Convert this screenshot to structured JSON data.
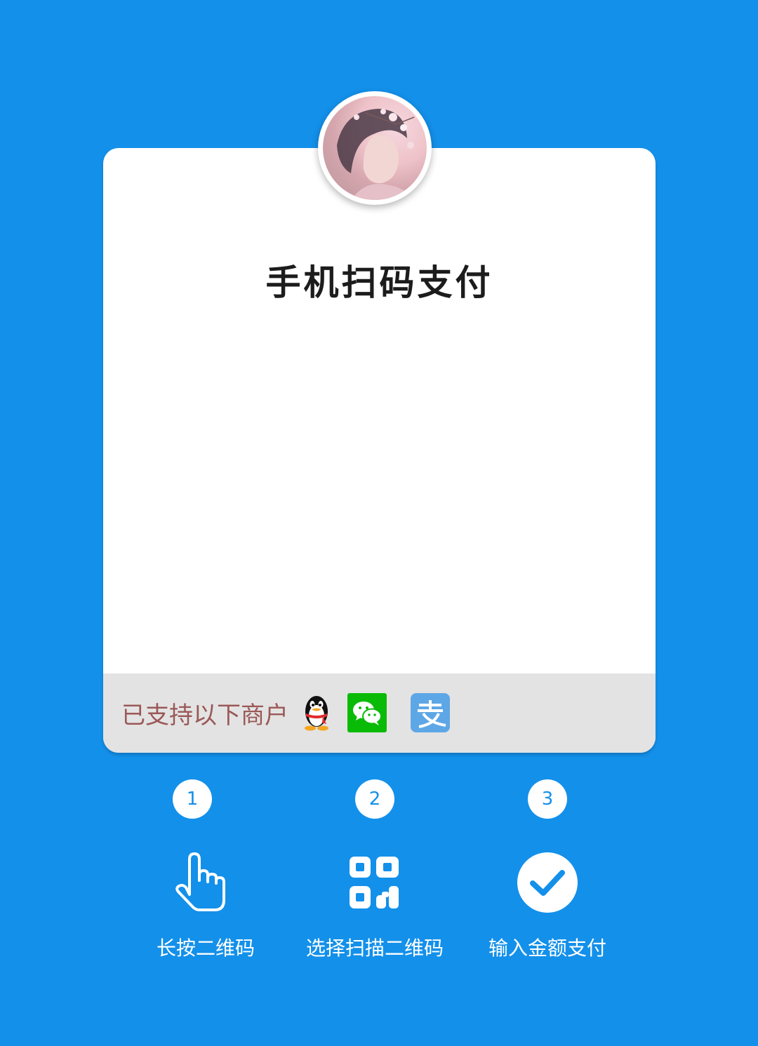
{
  "colors": {
    "background": "#1390ea",
    "card": "#ffffff",
    "footer_bar": "#e3e3e3",
    "footer_text": "#9b5858",
    "wechat_green": "#09bb07",
    "alipay_blue": "#5ea7e6"
  },
  "avatar": {
    "icon": "user-avatar"
  },
  "card": {
    "title": "手机扫码支付"
  },
  "merchants": {
    "label": "已支持以下商户",
    "icons": [
      "qq-penguin-icon",
      "wechat-icon",
      "alipay-icon"
    ]
  },
  "steps": [
    {
      "number": "1",
      "icon": "hand-pointer-icon",
      "label": "长按二维码"
    },
    {
      "number": "2",
      "icon": "qr-code-icon",
      "label": "选择扫描二维码"
    },
    {
      "number": "3",
      "icon": "check-circle-icon",
      "label": "输入金额支付"
    }
  ]
}
